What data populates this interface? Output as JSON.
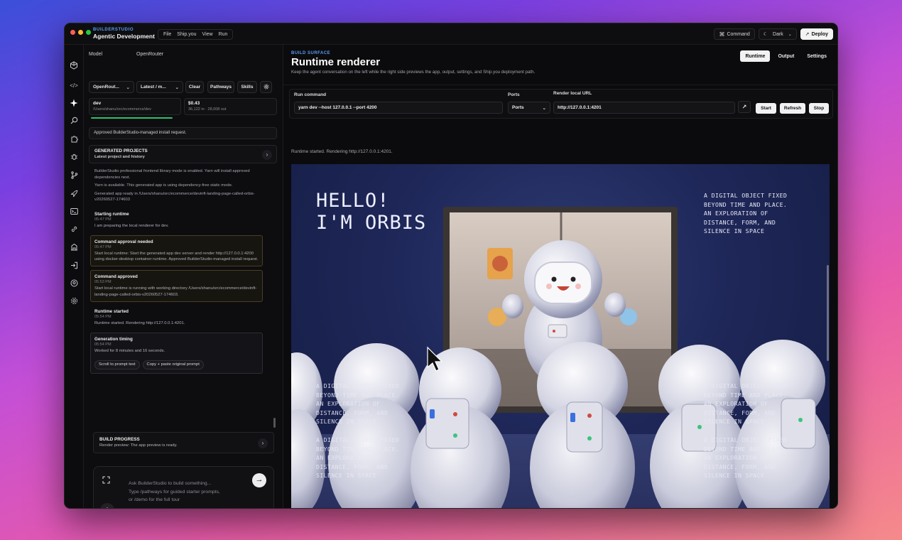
{
  "titlebar": {
    "brand_top": "BUILDERSTUDIO",
    "brand_name": "Agentic Development",
    "menu": [
      "File",
      "Ship.you",
      "View",
      "Run"
    ],
    "command_label": "Command",
    "theme_label": "Dark",
    "deploy_label": "Deploy"
  },
  "left": {
    "model_label": "Model",
    "openrouter_label": "OpenRouter",
    "model_select": "OpenRout...",
    "version_select": "Latest / m...",
    "clear_label": "Clear",
    "pathways_label": "Pathways",
    "skills_label": "Skills",
    "env_name": "dev",
    "env_path": "/Users/shanu/src/ecommerce/dev",
    "cost": "$0.43",
    "tokens": "36,122 in · 28,008 out",
    "approved_notice": "Approved BuilderStudio-managed install request.",
    "generated_title": "GENERATED PROJECTS",
    "generated_sub": "Latest project and history",
    "feed_lines": [
      "BuilderStudio professional frontend library mode is enabled. Yarn will install approved dependencies next.",
      "Yarn is available. This generated app is using dependency-free static mode.",
      "Generated app ready in /Users/shanu/src/ecommerce/devinft-landing-page-called-orbis-v20260527-174603"
    ],
    "events": [
      {
        "title": "Starting runtime",
        "time": "05:47 PM",
        "body": "I am preparing the local renderer for dev."
      },
      {
        "title": "Command approval needed",
        "time": "05:47 PM",
        "body": "Start local runtime: Start the generated app dev server and render http://127.0.0.1:4200 using docker-desktop container runtime. Approved BuilderStudio-managed install request."
      },
      {
        "title": "Command approved",
        "time": "05:53 PM",
        "body": "Start local runtime is running with working directory /Users/shanu/src/ecommerce/devinft-landing-page-called-orbis-v20260527-174603."
      },
      {
        "title": "Runtime started",
        "time": "05:54 PM",
        "body": "Runtime started. Rendering http://127.0.0.1:4201."
      },
      {
        "title": "Generation timing",
        "time": "05:54 PM",
        "body": "Worked for 8 minutes and 16 seconds."
      }
    ],
    "scroll_prompt_btn": "Scroll to prompt text",
    "copy_prompt_btn": "Copy + paste original prompt",
    "build_progress_title": "BUILD PROGRESS",
    "build_progress_sub": "Render preview: The app preview is ready.",
    "composer_placeholder_1": "Ask BuilderStudio to build something...",
    "composer_placeholder_2": "Type /pathways for guided starter prompts,",
    "composer_placeholder_3": "or /demo for the full tour"
  },
  "right": {
    "tag": "BUILD SURFACE",
    "title": "Runtime renderer",
    "subtitle": "Keep the agent conversation on the left while the right side previews the app, output, settings, and Ship.you deployment path.",
    "tabs": [
      "Runtime",
      "Output",
      "Settings"
    ],
    "run_command_label": "Run command",
    "run_command_value": "yarn dev --host 127.0.0.1 --port 4200",
    "ports_label": "Ports",
    "ports_value": "Ports",
    "render_url_label": "Render local URL",
    "render_url_value": "http://127.0.0.1:4201",
    "start_label": "Start",
    "refresh_label": "Refresh",
    "stop_label": "Stop",
    "runtime_msg": "Runtime started. Rendering http://127.0.0.1:4201."
  },
  "preview": {
    "hello_1": "HELLO!",
    "hello_2": "I'M ORBIS",
    "blurb": "A DIGITAL OBJECT FIXED\nBEYOND TIME AND PLACE.\nAN EXPLORATION OF\nDISTANCE, FORM, AND\nSILENCE IN SPACE"
  },
  "colors": {
    "accent": "#5b9cf5",
    "approval_border": "#4a3f23"
  }
}
